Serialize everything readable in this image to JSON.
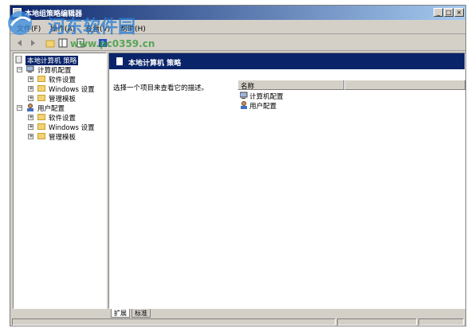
{
  "window": {
    "title": "本地组策略编辑器",
    "controls": {
      "minimize": "_",
      "maximize": "□",
      "close": "×"
    }
  },
  "menubar": {
    "items": [
      "文件(F)",
      "操作(A)",
      "查看(V)",
      "帮助(H)"
    ]
  },
  "toolbar": {
    "buttons": [
      "back-icon",
      "forward-icon",
      "up-icon",
      "show-hide-tree-icon",
      "properties-icon",
      "help-icon"
    ]
  },
  "tree": {
    "root": "本地计算机 策略",
    "computer": {
      "label": "计算机配置",
      "children": [
        "软件设置",
        "Windows 设置",
        "管理模板"
      ]
    },
    "user": {
      "label": "用户配置",
      "children": [
        "软件设置",
        "Windows 设置",
        "管理模板"
      ]
    }
  },
  "right": {
    "header": "本地计算机 策略",
    "description": "选择一个项目来查看它的描述。",
    "column_name": "名称",
    "items": [
      "计算机配置",
      "用户配置"
    ]
  },
  "tabs": [
    "扩展",
    "标准"
  ],
  "watermark": {
    "text": "河东软件园",
    "url": "www.pc0359.cn"
  },
  "colors": {
    "title_start": "#0a246a",
    "title_end": "#a6caf0",
    "selection": "#0a246a",
    "face": "#d4d0c8"
  }
}
